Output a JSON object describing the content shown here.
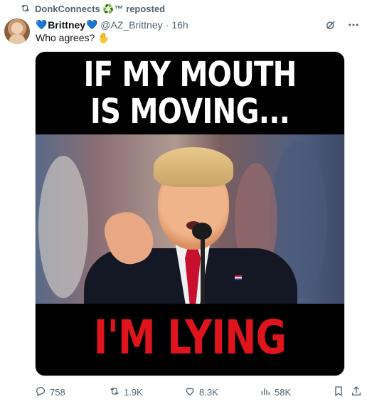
{
  "repost": {
    "label": "DonkConnects ♻️™ reposted"
  },
  "author": {
    "heart_left": "💙",
    "name": "Brittney",
    "heart_right": "💙",
    "handle": "@AZ_Brittney",
    "separator": "·",
    "time": "16h"
  },
  "tweet": {
    "text": "Who agrees?",
    "emoji": "✋"
  },
  "meme": {
    "top_line_1": "IF MY MOUTH",
    "top_line_2": "IS MOVING...",
    "bottom_line": "I'M LYING"
  },
  "stats": {
    "replies": "758",
    "reposts": "1.9K",
    "likes": "8.3K",
    "views": "58K"
  },
  "icons": {
    "repost": "repost-icon",
    "grok": "grok-icon",
    "more": "more-icon",
    "reply": "reply-icon",
    "like": "heart-icon",
    "views": "views-icon",
    "bookmark": "bookmark-icon",
    "share": "share-icon"
  },
  "colors": {
    "muted": "#536471",
    "red_text": "#e0141c",
    "accent": "#1d9bf0"
  }
}
